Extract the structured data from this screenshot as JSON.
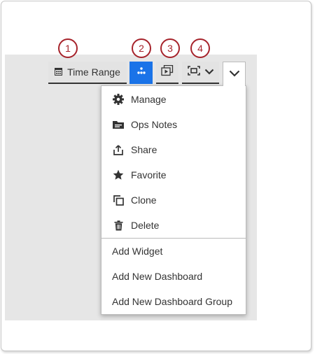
{
  "callouts": [
    "1",
    "2",
    "3",
    "4"
  ],
  "toolbar": {
    "time_range_label": "Time Range",
    "share_button_color": "#1a73e8"
  },
  "menu": {
    "items": [
      {
        "label": "Manage",
        "icon": "gear-icon"
      },
      {
        "label": "Ops Notes",
        "icon": "notes-icon"
      },
      {
        "label": "Share",
        "icon": "share-icon"
      },
      {
        "label": "Favorite",
        "icon": "star-icon"
      },
      {
        "label": "Clone",
        "icon": "clone-icon"
      },
      {
        "label": "Delete",
        "icon": "trash-icon"
      }
    ],
    "actions": [
      {
        "label": "Add Widget"
      },
      {
        "label": "Add New Dashboard"
      },
      {
        "label": "Add New Dashboard Group"
      }
    ]
  },
  "colors": {
    "callout": "#a6232b",
    "panel_background": "#e6e6e6"
  }
}
